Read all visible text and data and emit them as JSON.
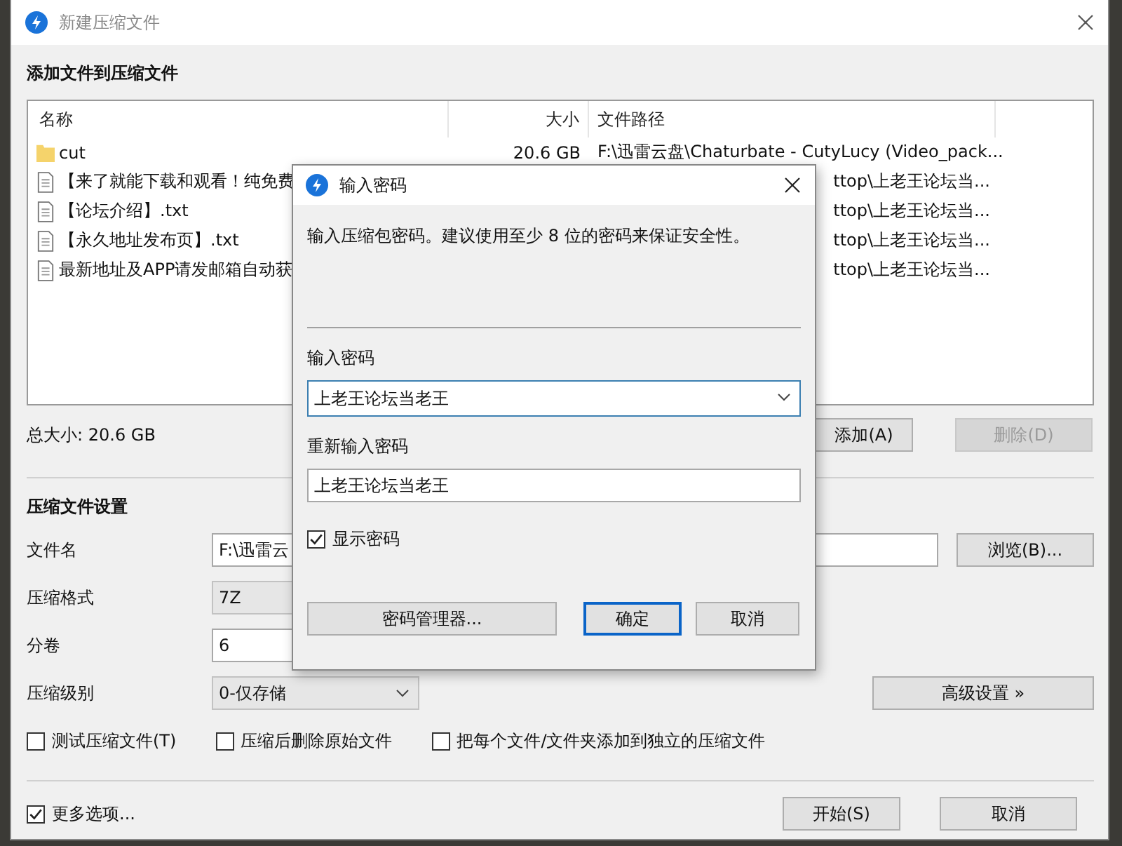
{
  "window": {
    "title": "新建压缩文件"
  },
  "files_section": {
    "title": "添加文件到压缩文件",
    "columns": [
      "名称",
      "大小",
      "文件路径"
    ],
    "rows": [
      {
        "kind": "folder",
        "name": "cut",
        "size": "20.6 GB",
        "path": "F:\\迅雷云盘\\Chaturbate - CutyLucy (Video_pack..."
      },
      {
        "kind": "file",
        "name": "【来了就能下载和观看！纯免费",
        "path": "ttop\\上老王论坛当..."
      },
      {
        "kind": "file",
        "name": "【论坛介绍】.txt",
        "path": "ttop\\上老王论坛当..."
      },
      {
        "kind": "file",
        "name": "【永久地址发布页】.txt",
        "path": "ttop\\上老王论坛当..."
      },
      {
        "kind": "file",
        "name": "最新地址及APP请发邮箱自动获",
        "path": "ttop\\上老王论坛当..."
      }
    ],
    "total": "总大小: 20.6 GB",
    "buttons": [
      {
        "label": "添加(A)",
        "disabled": false
      },
      {
        "label": "删除(D)",
        "disabled": true
      }
    ]
  },
  "settings": {
    "title": "压缩文件设置",
    "fields": [
      {
        "label": "文件名",
        "kind": "input",
        "value": "F:\\迅雷云"
      },
      {
        "label": "压缩格式",
        "kind": "combo",
        "value": "7Z"
      },
      {
        "label": "分卷",
        "kind": "input",
        "value": "6"
      },
      {
        "label": "压缩级别",
        "kind": "dropdown",
        "value": "0-仅存储"
      }
    ],
    "browse_button": "浏览(B)...",
    "advanced_button": "高级设置 »",
    "options": [
      {
        "label": "测试压缩文件(T)",
        "checked": false
      },
      {
        "label": "压缩后删除原始文件",
        "checked": false
      },
      {
        "label": "把每个文件/文件夹添加到独立的压缩文件",
        "checked": false
      }
    ]
  },
  "footer": {
    "more_options": {
      "label": "更多选项...",
      "checked": true
    },
    "buttons": [
      "开始(S)",
      "取消"
    ]
  },
  "dialog": {
    "title": "输入密码",
    "message": "输入压缩包密码。建议使用至少 8 位的密码来保证安全性。",
    "password_label": "输入密码",
    "password": "上老王论坛当老王",
    "repeat_label": "重新输入密码",
    "repeat": "上老王论坛当老王",
    "show_password": {
      "label": "显示密码",
      "checked": true
    },
    "manager_button": "密码管理器...",
    "ok_button": "确定",
    "cancel_button": "取消"
  }
}
